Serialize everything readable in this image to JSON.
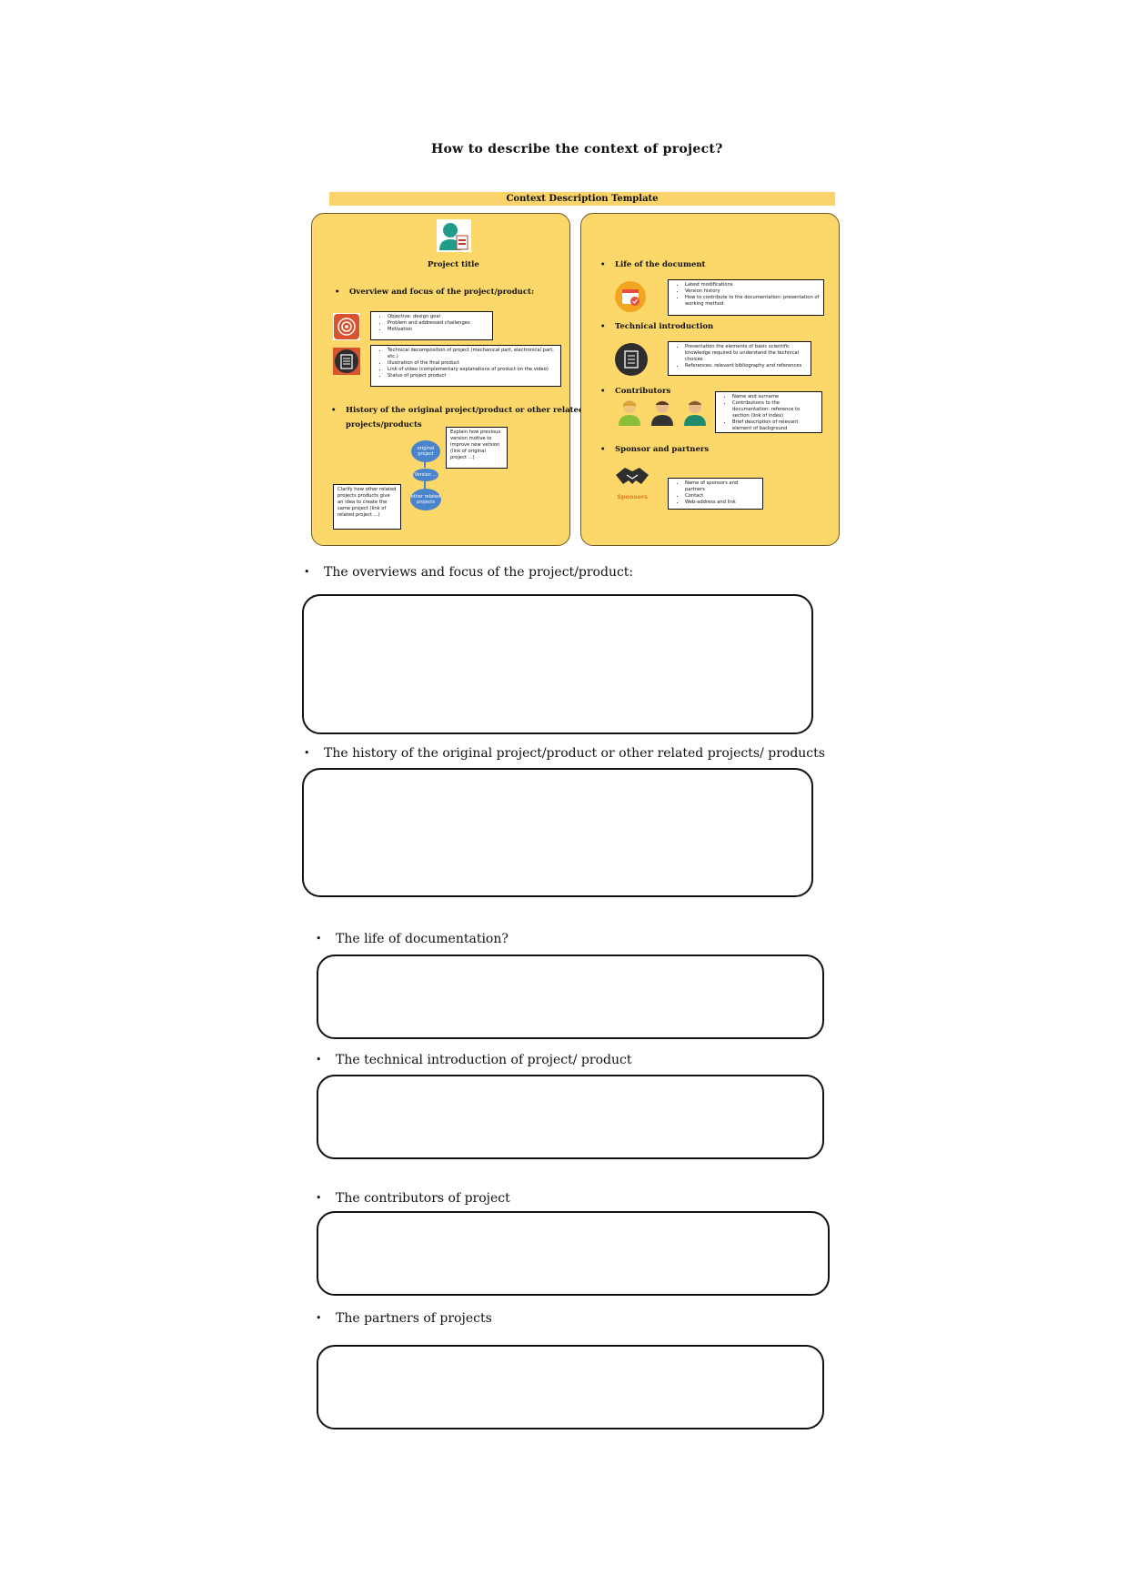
{
  "title": "How to describe the context of project?",
  "banner": "Context Description Template",
  "left_panel": {
    "project_title": "Project title",
    "overview_heading": "Overview and focus of the project/product:",
    "overview_note_1": [
      "Objective: design goal",
      "Problem and addressed challenges",
      "Motivation"
    ],
    "overview_note_2": [
      "Technical decomposition of project (mechanical part, electronical part, etc.)",
      "Illustration of the final product",
      "Link of video (complementary explanations of product on the video)",
      "Status of project product"
    ],
    "history_heading_1": "History of the original project/product or other related",
    "history_heading_2": "projects/products",
    "history_note": "Explain how previous version motive to improve new version (link of original project ...)",
    "ellipse_original": "original project",
    "ellipse_version": "Version ...",
    "ellipse_other": "other related projects",
    "clarify_note": "Clarify how other related projects products give an idea to create the same project (link of related project ...)"
  },
  "right_panel": {
    "life_heading": "Life of the document",
    "life_note": [
      "Latest modifications",
      "Version history",
      "How to contribute to the documentation: presentation of working method"
    ],
    "tech_heading": "Technical introduction",
    "tech_note": [
      "Presentation the elements of basic scientific knowledge required to understand the technical choices",
      "References: relevant bibliography and references"
    ],
    "contrib_heading": "Contributors",
    "contrib_note": [
      "Name and surname",
      "Contributions to the documentation: reference to section (link of index)",
      "Brief description of relevant element of background"
    ],
    "sponsor_heading": "Sponsor and partners",
    "sponsor_logo_text": "Sponsors",
    "sponsor_note": [
      "Name of sponsors and partners",
      "Contact",
      "Web-address and link"
    ]
  },
  "sections": {
    "s1": "The overviews and focus of the project/product:",
    "s2": "The history of the original project/product or other related projects/ products",
    "s3": "The life of documentation?",
    "s4": "The technical introduction of project/ product",
    "s5": "The contributors of project",
    "s6": "The partners of projects"
  },
  "colors": {
    "panel": "#fcd76a",
    "banner": "#fad46b",
    "ellipse": "#4a84cc",
    "person_icon": "#1f9c8a",
    "calendar_icon": "#f2a51f",
    "target_icon": "#d9532f",
    "sponsor_text": "#e07a1f"
  },
  "icons": [
    "person-doc-icon",
    "target-icon",
    "clipboard-icon",
    "calendar-icon",
    "clipboard-dark-icon",
    "person-icon",
    "handshake-icon"
  ]
}
